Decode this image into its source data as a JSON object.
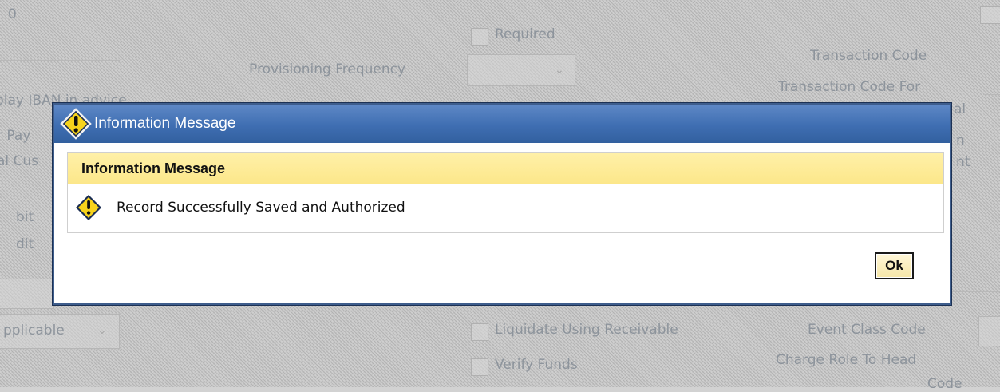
{
  "background": {
    "top_left_text": "0",
    "required_label": "Required",
    "provisioning_frequency_label": "Provisioning Frequency",
    "transaction_code_label": "Transaction Code",
    "transaction_code_for_label": "Transaction Code For",
    "left_label_1": "play IBAN in advice",
    "left_label_2": "r Pay",
    "left_label_3": "al Cus",
    "left_label_4": "bit",
    "left_label_5": "dit",
    "right_fragment_1": "al",
    "right_fragment_2": "n",
    "right_fragment_3": "nt",
    "not_applicable_value": "pplicable",
    "liquidate_label": "Liquidate Using Receivable",
    "verify_funds_label": "Verify Funds",
    "event_class_code_label": "Event Class Code",
    "charge_role_label": "Charge Role To Head",
    "code_label": "Code"
  },
  "dialog": {
    "title": "Information Message",
    "panel_header": "Information Message",
    "message": "Record Successfully Saved and Authorized",
    "ok_label": "Ok",
    "warning_icon": "warning-icon"
  },
  "colors": {
    "titlebar": "#3f6eb2",
    "panel_header": "#fce78a",
    "warning_fill": "#f7d31c"
  }
}
